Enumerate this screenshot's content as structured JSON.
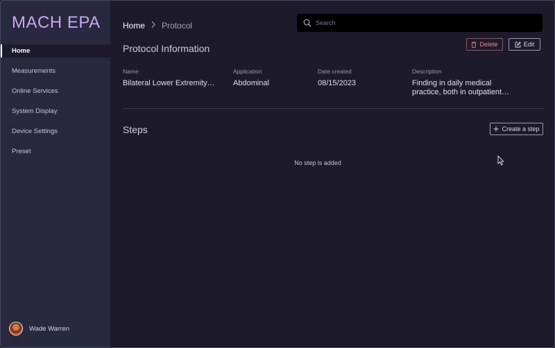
{
  "app": {
    "title": "MACH EPA"
  },
  "sidebar": {
    "items": [
      {
        "label": "Home",
        "active": true
      },
      {
        "label": "Measurements"
      },
      {
        "label": "Online Services"
      },
      {
        "label": "System Display"
      },
      {
        "label": "Device Settings"
      },
      {
        "label": "Preset"
      }
    ],
    "user": {
      "name": "Wade Warren",
      "avatar_icon": "avatar"
    }
  },
  "header": {
    "breadcrumb": {
      "home": "Home",
      "separator_icon": "chevron-right-icon",
      "current": "Protocol"
    },
    "search": {
      "placeholder": "Search",
      "value": ""
    }
  },
  "protocol_info": {
    "title": "Protocol Information",
    "delete_label": "Delete",
    "edit_label": "Edit",
    "fields": {
      "name": {
        "label": "Name",
        "value": "Bilateral Lower Extremity…"
      },
      "application": {
        "label": "Application",
        "value": "Abdominal"
      },
      "date_created": {
        "label": "Date created",
        "value": "08/15/2023"
      },
      "description": {
        "label": "Description",
        "line1": "Finding in daily medical",
        "line2": "practice, both in outpatient…"
      }
    }
  },
  "steps": {
    "title": "Steps",
    "create_label": "Create a step",
    "empty_text": "No step is added"
  },
  "colors": {
    "background": "#1d1b2b",
    "sidebar": "#28283f",
    "brand": "#c9a7ee",
    "danger": "#e2858f"
  }
}
